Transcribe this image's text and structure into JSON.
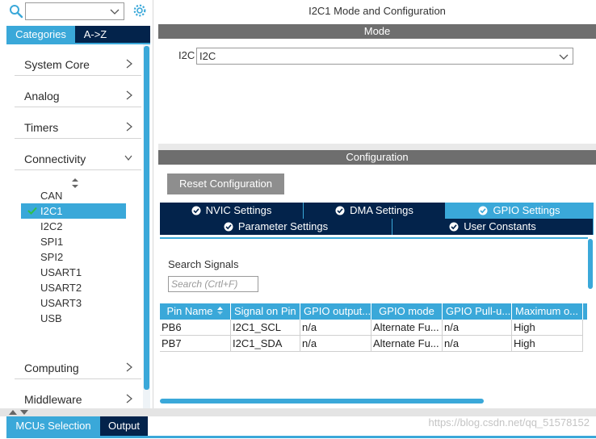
{
  "left": {
    "search": {
      "value": ""
    },
    "tabs": {
      "categories": "Categories",
      "az": "A->Z"
    },
    "categories": [
      {
        "label": "System Core"
      },
      {
        "label": "Analog"
      },
      {
        "label": "Timers"
      },
      {
        "label": "Connectivity"
      },
      {
        "label": "Computing"
      },
      {
        "label": "Middleware"
      }
    ],
    "connectivity_items": [
      "CAN",
      "I2C1",
      "I2C2",
      "SPI1",
      "SPI2",
      "USART1",
      "USART2",
      "USART3",
      "USB"
    ],
    "selected_item": "I2C1"
  },
  "right": {
    "title": "I2C1 Mode and Configuration",
    "mode_header": "Mode",
    "mode_label": "I2C",
    "mode_value": "I2C",
    "config_header": "Configuration",
    "reset_button": "Reset Configuration",
    "tabs_row1": [
      "NVIC Settings",
      "DMA Settings",
      "GPIO Settings"
    ],
    "tabs_row2": [
      "Parameter Settings",
      "User Constants"
    ],
    "active_tab": "GPIO Settings",
    "search_signals_label": "Search Signals",
    "search_signals_placeholder": "Search (Crtl+F)",
    "table": {
      "columns": [
        "Pin Name",
        "Signal on Pin",
        "GPIO output...",
        "GPIO mode",
        "GPIO Pull-u...",
        "Maximum o..."
      ],
      "rows": [
        [
          "PB6",
          "I2C1_SCL",
          "n/a",
          "Alternate Fu...",
          "n/a",
          "High"
        ],
        [
          "PB7",
          "I2C1_SDA",
          "n/a",
          "Alternate Fu...",
          "n/a",
          "High"
        ]
      ]
    }
  },
  "bottom": {
    "tabs": [
      "MCUs Selection",
      "Output"
    ],
    "watermark": "https://blog.csdn.net/qq_51578152"
  },
  "colors": {
    "accent": "#3aa8d9",
    "navy": "#03234b",
    "header_gray": "#6e6e6e",
    "button_gray": "#8e8e8e"
  }
}
